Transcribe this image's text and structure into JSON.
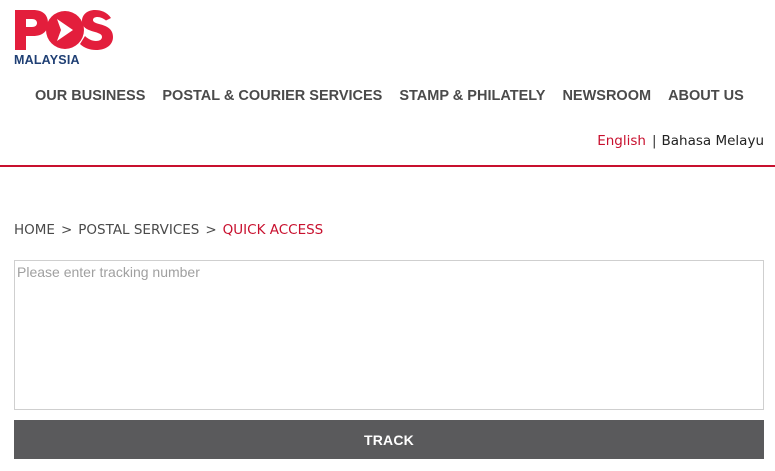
{
  "brand": {
    "logo_text": "POS",
    "logo_subtext": "MALAYSIA",
    "primary_color": "#e31e3c",
    "secondary_color": "#1f3f74"
  },
  "nav": {
    "items": [
      {
        "label": "OUR BUSINESS"
      },
      {
        "label": "POSTAL & COURIER SERVICES"
      },
      {
        "label": "STAMP & PHILATELY"
      },
      {
        "label": "NEWSROOM"
      },
      {
        "label": "ABOUT US"
      }
    ]
  },
  "language": {
    "english": "English",
    "separator": "|",
    "malay": "Bahasa Melayu",
    "active": "English"
  },
  "breadcrumb": {
    "home": "HOME",
    "separator": ">",
    "section": "POSTAL SERVICES",
    "current": "QUICK ACCESS"
  },
  "tracking": {
    "placeholder": "Please enter tracking number",
    "value": "",
    "button_label": "TRACK"
  },
  "colors": {
    "accent_red": "#c8102e",
    "button_gray": "#5a5a5c"
  }
}
